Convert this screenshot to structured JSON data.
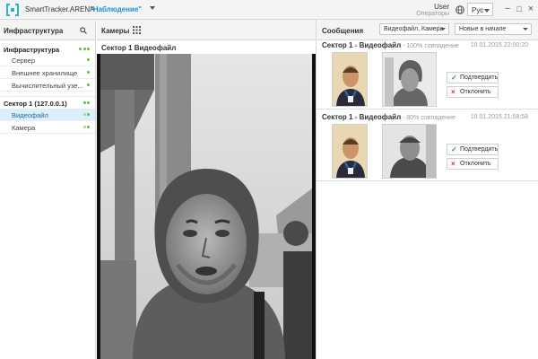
{
  "app": {
    "name": "SmartTracker.ARENA",
    "mode": "\"Наблюдение\"",
    "user_name": "User",
    "user_role": "Операторы",
    "language": "Рус"
  },
  "window_controls": {
    "minimize": "–",
    "maximize": "□",
    "close": "×"
  },
  "panels": {
    "infrastructure_title": "Инфраструктура",
    "cameras_title": "Камеры",
    "messages_title": "Сообщения"
  },
  "filters": {
    "source": "Видеофайл, Камера",
    "sort": "Новые в начале"
  },
  "sidebar": {
    "groups": [
      {
        "label": "Инфраструктура",
        "items": [
          {
            "label": "Сервер"
          },
          {
            "label": "Внешнее хранилище"
          },
          {
            "label": "Вычислительный узе..."
          }
        ]
      },
      {
        "label": "Сектор 1 (127.0.0.1)",
        "items": [
          {
            "label": "Видеофайл",
            "selected": true
          },
          {
            "label": "Камера"
          }
        ]
      }
    ]
  },
  "camera": {
    "title": "Сектор 1 Видеофайл"
  },
  "messages": [
    {
      "source": "Сектор 1 - Видеофайл",
      "match": " - 100% совпадение",
      "time": "10.01.2015 22:00:20",
      "confirm": "Подтвердить",
      "reject": "Отклонить"
    },
    {
      "source": "Сектор 1 - Видеофайл",
      "match": " - 80% совпадение",
      "time": "10.01.2015 21:58:58",
      "confirm": "Подтвердить",
      "reject": "Отклонить"
    }
  ],
  "colors": {
    "accent": "#1f8fd0",
    "status_ok": "#5bc236",
    "selected_bg": "#dceefa"
  }
}
